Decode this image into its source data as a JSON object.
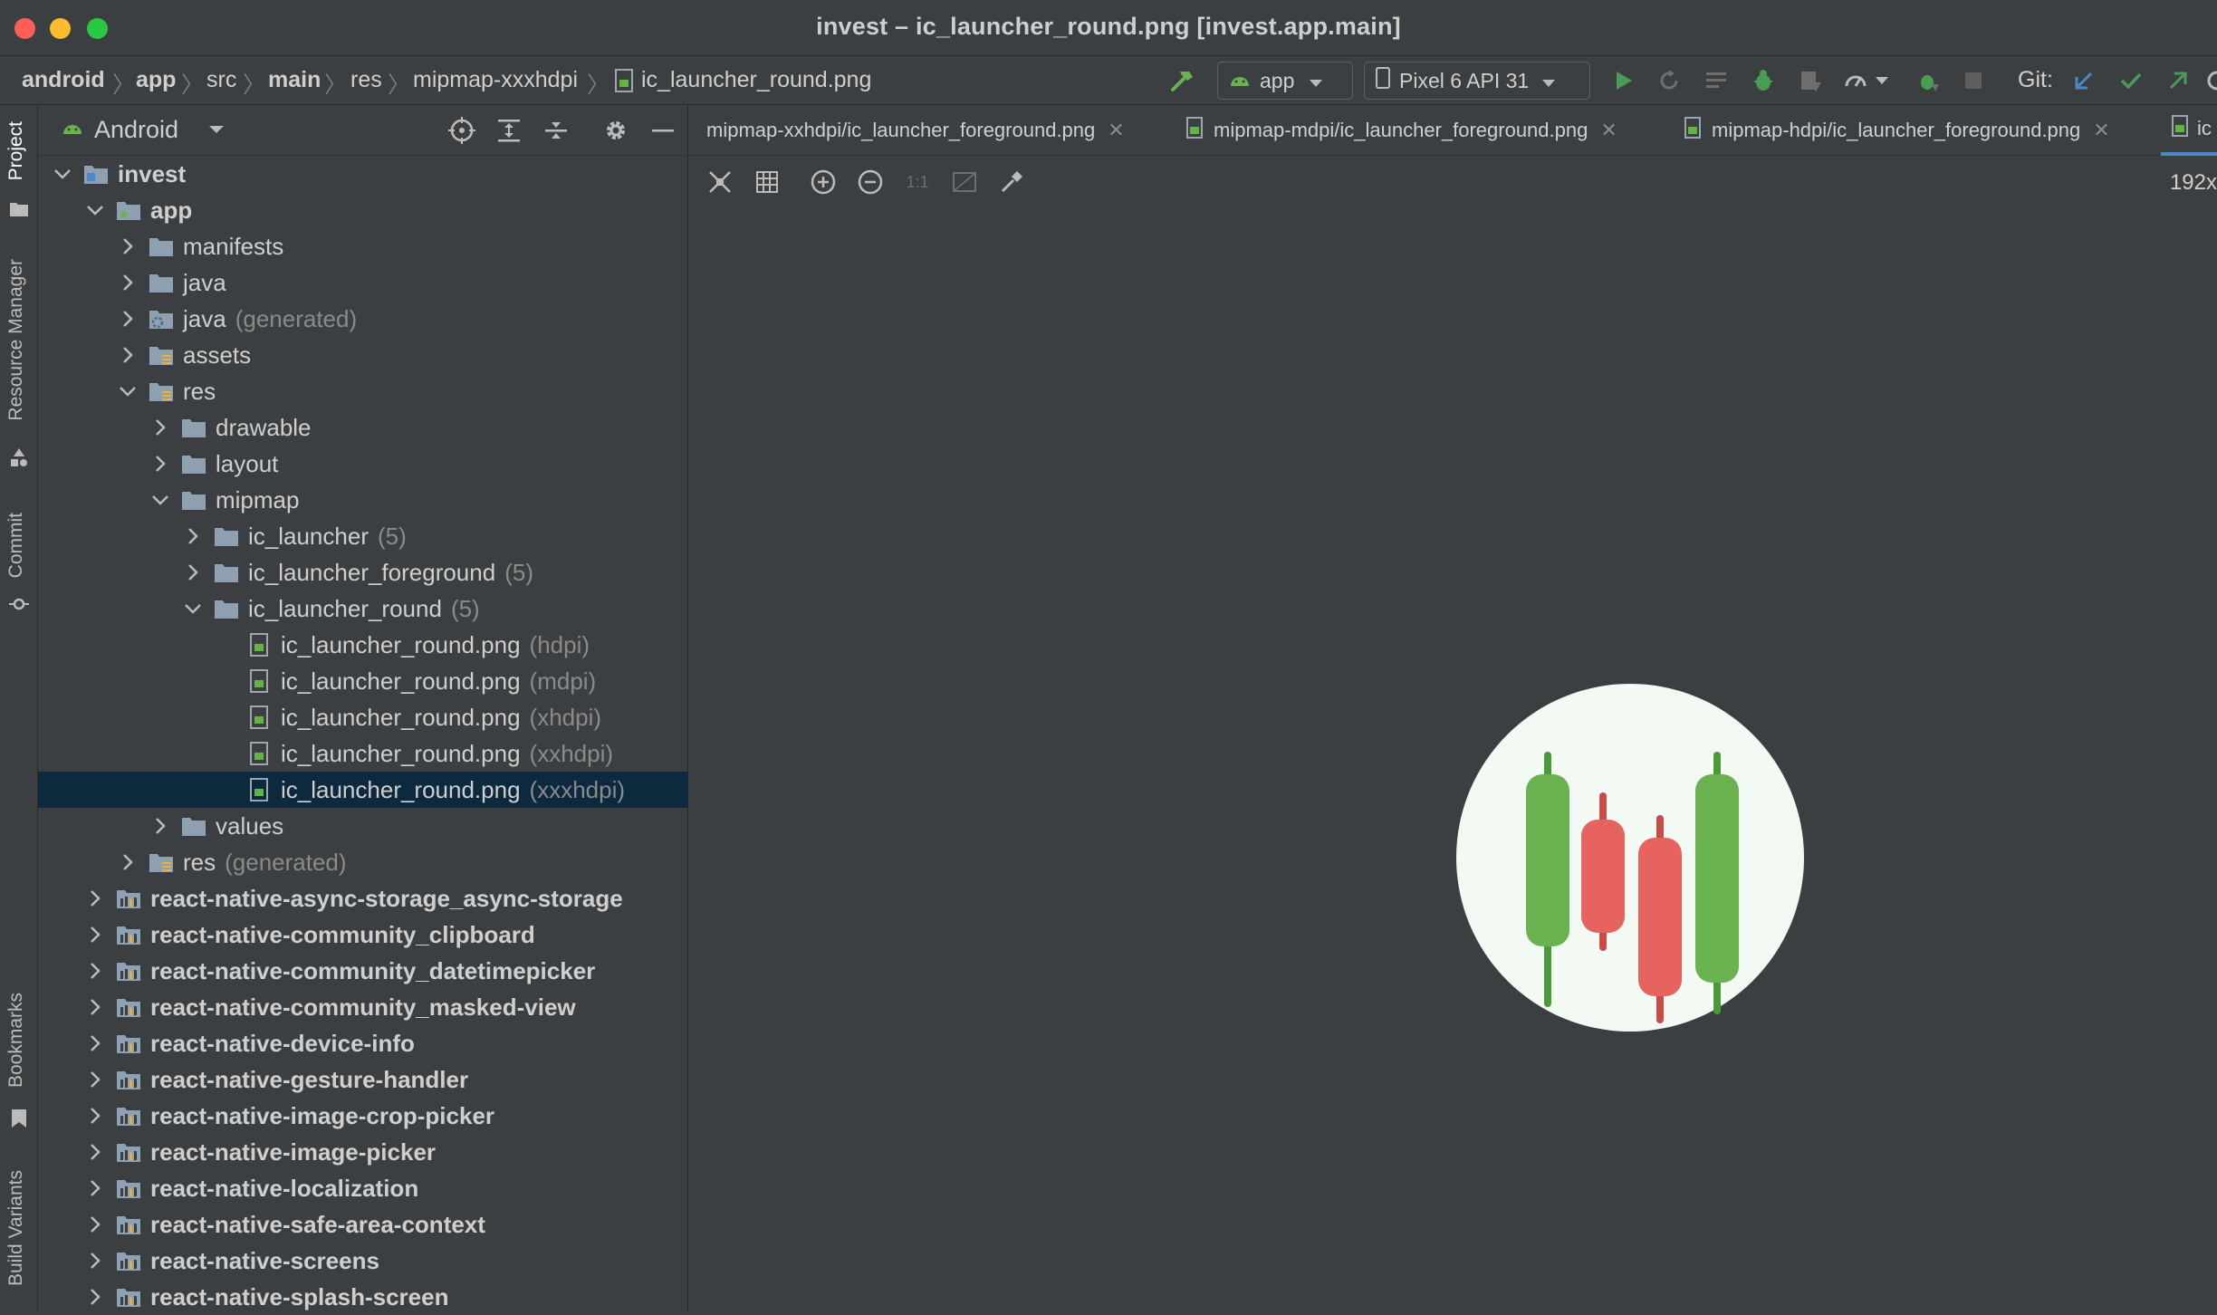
{
  "window": {
    "title": "invest – ic_launcher_round.png [invest.app.main]",
    "traffic_colors": [
      "#ff5f57",
      "#febc2e",
      "#28c840"
    ]
  },
  "breadcrumb": [
    "android",
    "app",
    "src",
    "main",
    "res",
    "mipmap-xxxhdpi",
    "ic_launcher_round.png"
  ],
  "toolbar": {
    "run_config": "app",
    "device": "Pixel 6 API 31",
    "git_label": "Git:"
  },
  "tool_windows": {
    "project": "Project",
    "resource_manager": "Resource Manager",
    "commit": "Commit",
    "bookmarks": "Bookmarks",
    "build_variants": "Build Variants"
  },
  "project_panel": {
    "view_mode": "Android"
  },
  "tree": [
    {
      "label": "invest",
      "hint": "",
      "level": 0,
      "expanded": true,
      "bold": true,
      "icon": "project-folder-icon"
    },
    {
      "label": "app",
      "hint": "",
      "level": 1,
      "expanded": true,
      "bold": true,
      "icon": "module-folder-icon"
    },
    {
      "label": "manifests",
      "hint": "",
      "level": 2,
      "expanded": false,
      "icon": "folder-icon"
    },
    {
      "label": "java",
      "hint": "",
      "level": 2,
      "expanded": false,
      "icon": "folder-icon"
    },
    {
      "label": "java",
      "hint": "(generated)",
      "level": 2,
      "expanded": false,
      "icon": "generated-folder-icon"
    },
    {
      "label": "assets",
      "hint": "",
      "level": 2,
      "expanded": false,
      "icon": "resource-folder-icon"
    },
    {
      "label": "res",
      "hint": "",
      "level": 2,
      "expanded": true,
      "icon": "resource-folder-icon"
    },
    {
      "label": "drawable",
      "hint": "",
      "level": 3,
      "expanded": false,
      "icon": "folder-icon"
    },
    {
      "label": "layout",
      "hint": "",
      "level": 3,
      "expanded": false,
      "icon": "folder-icon"
    },
    {
      "label": "mipmap",
      "hint": "",
      "level": 3,
      "expanded": true,
      "icon": "folder-icon"
    },
    {
      "label": "ic_launcher",
      "hint": "(5)",
      "level": 4,
      "expanded": false,
      "icon": "folder-icon"
    },
    {
      "label": "ic_launcher_foreground",
      "hint": "(5)",
      "level": 4,
      "expanded": false,
      "icon": "folder-icon"
    },
    {
      "label": "ic_launcher_round",
      "hint": "(5)",
      "level": 4,
      "expanded": true,
      "icon": "folder-icon"
    },
    {
      "label": "ic_launcher_round.png",
      "hint": "(hdpi)",
      "level": 5,
      "leaf": true,
      "icon": "image-file-icon"
    },
    {
      "label": "ic_launcher_round.png",
      "hint": "(mdpi)",
      "level": 5,
      "leaf": true,
      "icon": "image-file-icon"
    },
    {
      "label": "ic_launcher_round.png",
      "hint": "(xhdpi)",
      "level": 5,
      "leaf": true,
      "icon": "image-file-icon"
    },
    {
      "label": "ic_launcher_round.png",
      "hint": "(xxhdpi)",
      "level": 5,
      "leaf": true,
      "icon": "image-file-icon"
    },
    {
      "label": "ic_launcher_round.png",
      "hint": "(xxxhdpi)",
      "level": 5,
      "leaf": true,
      "selected": true,
      "icon": "image-file-icon"
    },
    {
      "label": "values",
      "hint": "",
      "level": 3,
      "expanded": false,
      "icon": "folder-icon"
    },
    {
      "label": "res",
      "hint": "(generated)",
      "level": 2,
      "expanded": false,
      "icon": "resource-folder-icon"
    },
    {
      "label": "react-native-async-storage_async-storage",
      "hint": "",
      "level": 1,
      "expanded": false,
      "bold": true,
      "icon": "library-module-icon"
    },
    {
      "label": "react-native-community_clipboard",
      "hint": "",
      "level": 1,
      "expanded": false,
      "bold": true,
      "icon": "library-module-icon"
    },
    {
      "label": "react-native-community_datetimepicker",
      "hint": "",
      "level": 1,
      "expanded": false,
      "bold": true,
      "icon": "library-module-icon"
    },
    {
      "label": "react-native-community_masked-view",
      "hint": "",
      "level": 1,
      "expanded": false,
      "bold": true,
      "icon": "library-module-icon"
    },
    {
      "label": "react-native-device-info",
      "hint": "",
      "level": 1,
      "expanded": false,
      "bold": true,
      "icon": "library-module-icon"
    },
    {
      "label": "react-native-gesture-handler",
      "hint": "",
      "level": 1,
      "expanded": false,
      "bold": true,
      "icon": "library-module-icon"
    },
    {
      "label": "react-native-image-crop-picker",
      "hint": "",
      "level": 1,
      "expanded": false,
      "bold": true,
      "icon": "library-module-icon"
    },
    {
      "label": "react-native-image-picker",
      "hint": "",
      "level": 1,
      "expanded": false,
      "bold": true,
      "icon": "library-module-icon"
    },
    {
      "label": "react-native-localization",
      "hint": "",
      "level": 1,
      "expanded": false,
      "bold": true,
      "icon": "library-module-icon"
    },
    {
      "label": "react-native-safe-area-context",
      "hint": "",
      "level": 1,
      "expanded": false,
      "bold": true,
      "icon": "library-module-icon"
    },
    {
      "label": "react-native-screens",
      "hint": "",
      "level": 1,
      "expanded": false,
      "bold": true,
      "icon": "library-module-icon"
    },
    {
      "label": "react-native-splash-screen",
      "hint": "",
      "level": 1,
      "expanded": false,
      "bold": true,
      "icon": "library-module-icon"
    }
  ],
  "editor_tabs": [
    {
      "label": "mipmap-xxhdpi/ic_launcher_foreground.png"
    },
    {
      "label": "mipmap-mdpi/ic_launcher_foreground.png"
    },
    {
      "label": "mipmap-hdpi/ic_launcher_foreground.png"
    },
    {
      "label": "ic"
    }
  ],
  "image_viewer": {
    "size_text": "192x",
    "icon_name": "candlestick-chart-icon",
    "colors": {
      "green": "#6ab150",
      "red": "#e6635f",
      "background": "#f2faf3"
    }
  }
}
